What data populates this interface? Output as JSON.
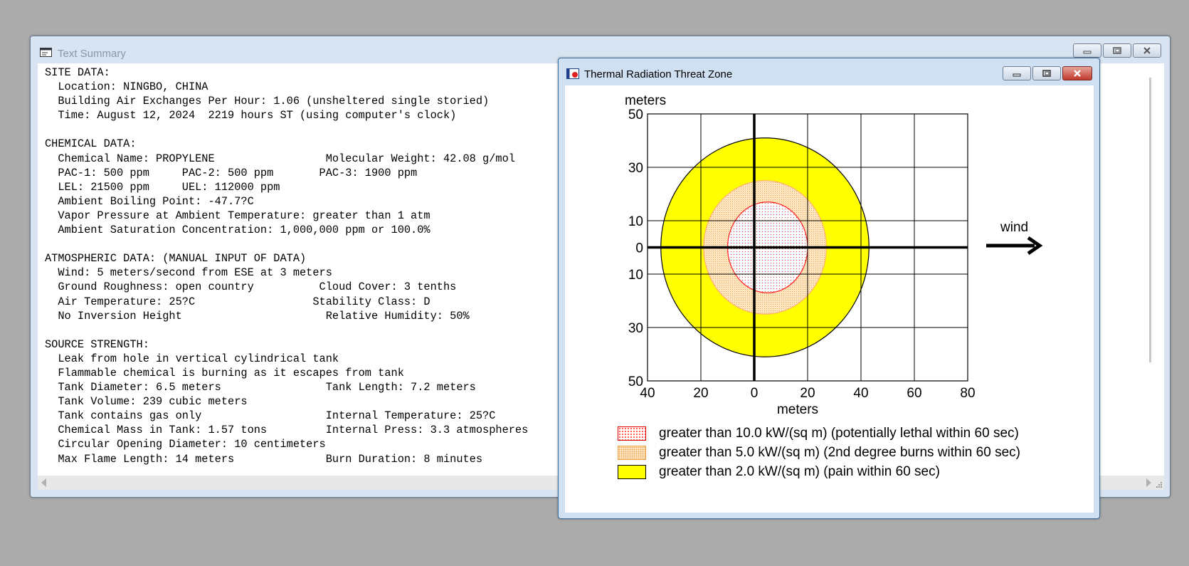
{
  "summary_window": {
    "title": "Text Summary",
    "icon": "text-window-icon",
    "controls": [
      "minimize-icon",
      "restore-icon",
      "close-icon"
    ],
    "lines": [
      "SITE DATA:",
      "  Location: NINGBO, CHINA",
      "  Building Air Exchanges Per Hour: 1.06 (unsheltered single storied)",
      "  Time: August 12, 2024  2219 hours ST (using computer's clock)",
      "",
      "CHEMICAL DATA:",
      "  Chemical Name: PROPYLENE                 Molecular Weight: 42.08 g/mol",
      "  PAC-1: 500 ppm     PAC-2: 500 ppm       PAC-3: 1900 ppm",
      "  LEL: 21500 ppm     UEL: 112000 ppm",
      "  Ambient Boiling Point: -47.7?C",
      "  Vapor Pressure at Ambient Temperature: greater than 1 atm",
      "  Ambient Saturation Concentration: 1,000,000 ppm or 100.0%",
      "",
      "ATMOSPHERIC DATA: (MANUAL INPUT OF DATA)",
      "  Wind: 5 meters/second from ESE at 3 meters",
      "  Ground Roughness: open country          Cloud Cover: 3 tenths",
      "  Air Temperature: 25?C                  Stability Class: D",
      "  No Inversion Height                      Relative Humidity: 50%",
      "",
      "SOURCE STRENGTH:",
      "  Leak from hole in vertical cylindrical tank",
      "  Flammable chemical is burning as it escapes from tank",
      "  Tank Diameter: 6.5 meters                Tank Length: 7.2 meters",
      "  Tank Volume: 239 cubic meters",
      "  Tank contains gas only                   Internal Temperature: 25?C",
      "  Chemical Mass in Tank: 1.57 tons         Internal Press: 3.3 atmospheres",
      "  Circular Opening Diameter: 10 centimeters",
      "  Max Flame Length: 14 meters              Burn Duration: 8 minutes"
    ]
  },
  "threat_window": {
    "title": "Thermal Radiation Threat Zone",
    "icon": "threat-zone-window-icon",
    "controls": [
      "minimize-icon",
      "restore-icon",
      "close-icon"
    ],
    "wind_label": "wind",
    "wind_icon": "wind-arrow-icon",
    "colors": {
      "lethal": "#ff0000",
      "burns": "#ffa060",
      "pain": "#ffff00"
    },
    "legend": [
      {
        "label": "greater than 10.0 kW/(sq m) (potentially lethal within 60 sec)"
      },
      {
        "label": "greater than 5.0 kW/(sq m) (2nd degree burns within 60 sec)"
      },
      {
        "label": "greater than 2.0 kW/(sq m) (pain within 60 sec)"
      }
    ]
  },
  "chart_data": {
    "type": "area",
    "xlabel": "meters",
    "ylabel": "meters",
    "xlim": [
      -40,
      80
    ],
    "ylim": [
      -50,
      50
    ],
    "x_ticks": [
      "40",
      "20",
      "0",
      "20",
      "40",
      "60",
      "80"
    ],
    "y_ticks": [
      "50",
      "30",
      "10",
      "0",
      "10",
      "30",
      "50"
    ],
    "grid": true,
    "zones": [
      {
        "name": "greater than 2.0 kW/(sq m) (pain within 60 sec)",
        "x_extent": [
          -35,
          43
        ],
        "y_extent": [
          -41,
          41
        ],
        "color": "#ffff00"
      },
      {
        "name": "greater than 5.0 kW/(sq m) (2nd degree burns within 60 sec)",
        "x_extent": [
          -19,
          27
        ],
        "y_extent": [
          -25,
          25
        ],
        "color": "#ffa060"
      },
      {
        "name": "greater than 10.0 kW/(sq m) (potentially lethal within 60 sec)",
        "x_extent": [
          -10,
          20
        ],
        "y_extent": [
          -17,
          17
        ],
        "color": "#ff0000"
      }
    ]
  }
}
